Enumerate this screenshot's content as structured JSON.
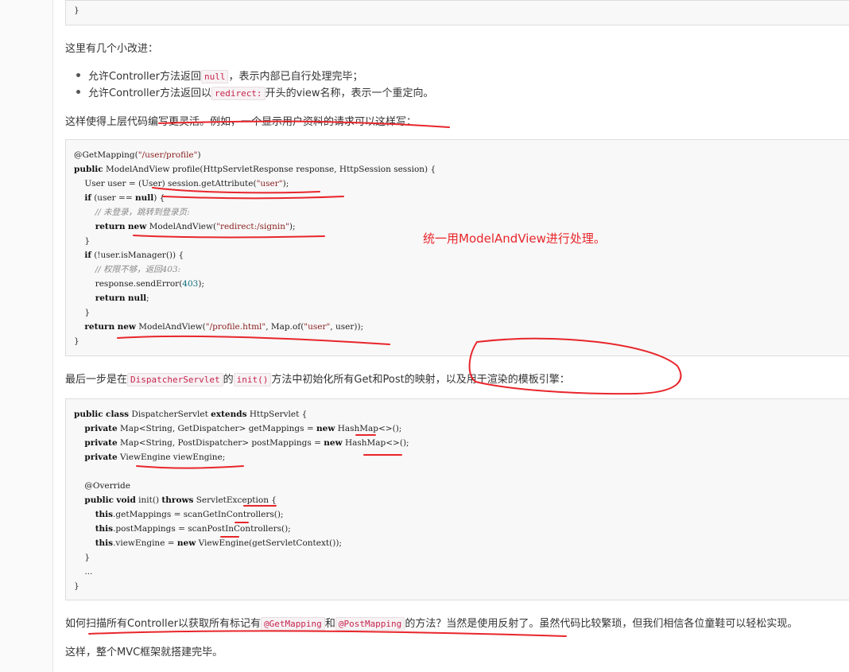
{
  "top_code_tail": "}",
  "intro_text": "这里有几个小改进：",
  "bullets": [
    {
      "before": "允许Controller方法返回",
      "code": "null",
      "after": "，表示内部已自行处理完毕；"
    },
    {
      "before": "允许Controller方法返回以",
      "code": "redirect:",
      "after": "开头的view名称，表示一个重定向。"
    }
  ],
  "flex_text": "这样使得上层代码编写更灵活。例如，一个显示用户资料的请求可以这样写：",
  "code1": {
    "lines": [
      "@GetMapping(\"/user/profile\")",
      "public ModelAndView profile(HttpServletResponse response, HttpSession session) {",
      "    User user = (User) session.getAttribute(\"user\");",
      "    if (user == null) {",
      "        // 未登录，跳转到登录页:",
      "        return new ModelAndView(\"redirect:/signin\");",
      "    }",
      "    if (!user.isManager()) {",
      "        // 权限不够，返回403:",
      "        response.sendError(403);",
      "        return null;",
      "    }",
      "    return new ModelAndView(\"/profile.html\", Map.of(\"user\", user));",
      "}"
    ]
  },
  "annotation_text": "统一用ModelAndView进行处理。",
  "last_step": {
    "before": "最后一步是在",
    "code1": "DispatcherServlet",
    "middle1": "的",
    "code2": "init()",
    "after": "方法中初始化所有Get和Post的映射，以及用于渲染的模板引擎："
  },
  "code2": {
    "lines": [
      "public class DispatcherServlet extends HttpServlet {",
      "    private Map<String, GetDispatcher> getMappings = new HashMap<>();",
      "    private Map<String, PostDispatcher> postMappings = new HashMap<>();",
      "    private ViewEngine viewEngine;",
      "",
      "    @Override",
      "    public void init() throws ServletException {",
      "        this.getMappings = scanGetInControllers();",
      "        this.postMappings = scanPostInControllers();",
      "        this.viewEngine = new ViewEngine(getServletContext());",
      "    }",
      "    ...",
      "}"
    ]
  },
  "scan_text": {
    "before": "如何扫描所有Controller以获取所有标记有",
    "code1": "@GetMapping",
    "middle": "和",
    "code2": "@PostMapping",
    "after": "的方法？当然是使用反射了。虽然代码比较繁琐，但我们相信各位童鞋可以轻松实现。"
  },
  "final_text": "这样，整个MVC框架就搭建完毕。",
  "colors": {
    "annotation": "#e8262b",
    "code_bg": "#f8f8f8",
    "inline_code": "#c7254e"
  }
}
